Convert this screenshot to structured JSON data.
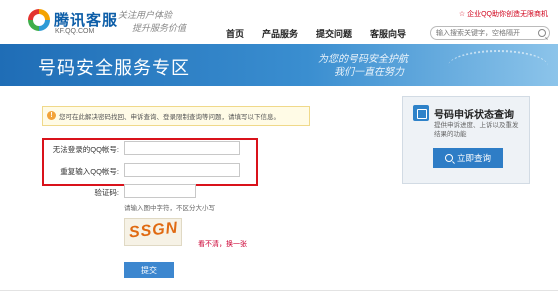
{
  "header": {
    "logo_title": "腾讯客服",
    "logo_sub": "KF.QQ.COM",
    "slogan_line1": "关注用户体验",
    "slogan_line2": "提升服务价值",
    "promo": "企业QQ助你创造无限商机",
    "nav": [
      "首页",
      "产品服务",
      "提交问题",
      "客服向导"
    ],
    "search_placeholder": "输入搜索关键字，空格隔开"
  },
  "banner": {
    "title": "号码安全服务专区",
    "script_line1": "为您的号码安全护航",
    "script_line2": "我们一直在努力"
  },
  "notice": {
    "icon": "!",
    "text": "您可在此解决密码找回、申诉查询、登录限制查询等问题，请填写以下信息。"
  },
  "form": {
    "qq_label": "无法登录的QQ帐号:",
    "qq_value": "",
    "qq_confirm_label": "重复输入QQ帐号:",
    "qq_confirm_value": "",
    "captcha_label": "验证码:",
    "captcha_value": "",
    "captcha_hint": "请输入图中字符，不区分大小写",
    "captcha_text": "SSGN",
    "refresh_text": "看不清，换一张",
    "submit_label": "提交"
  },
  "side": {
    "title": "号码申诉状态查询",
    "desc": "提供申诉进度、上诉以及重发结果的功能",
    "button_label": "立即查询"
  }
}
